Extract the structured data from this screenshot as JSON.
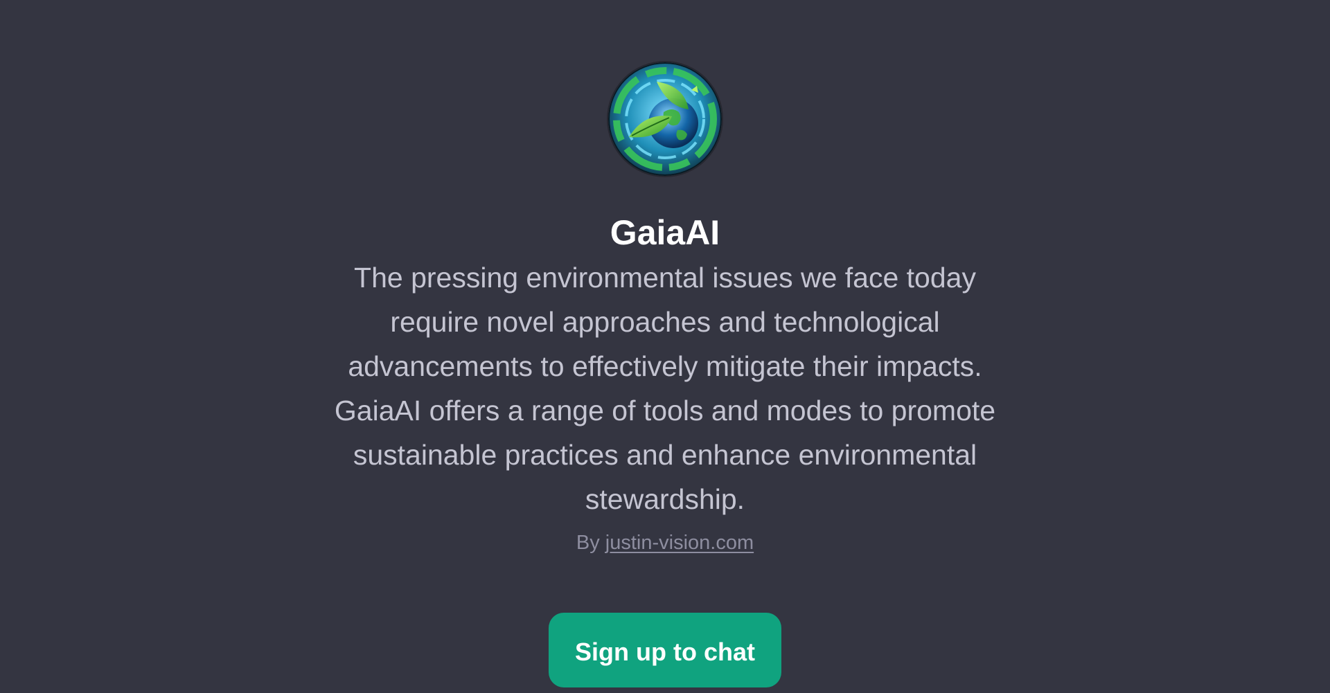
{
  "gpt": {
    "avatar_icon": "earth-leaf-icon",
    "name": "GaiaAI",
    "description": "The pressing environmental issues we face today require novel approaches and technological advancements to effectively mitigate their impacts. GaiaAI offers a range of tools and modes to promote sustainable practices and enhance environmental stewardship.",
    "byline_prefix": "By",
    "author": "justin-vision.com"
  },
  "actions": {
    "signup_label": "Sign up to chat"
  },
  "colors": {
    "background": "#343541",
    "title": "#ffffff",
    "description": "#c5c5d2",
    "byline": "#8e8ea0",
    "button": "#10a37f"
  }
}
